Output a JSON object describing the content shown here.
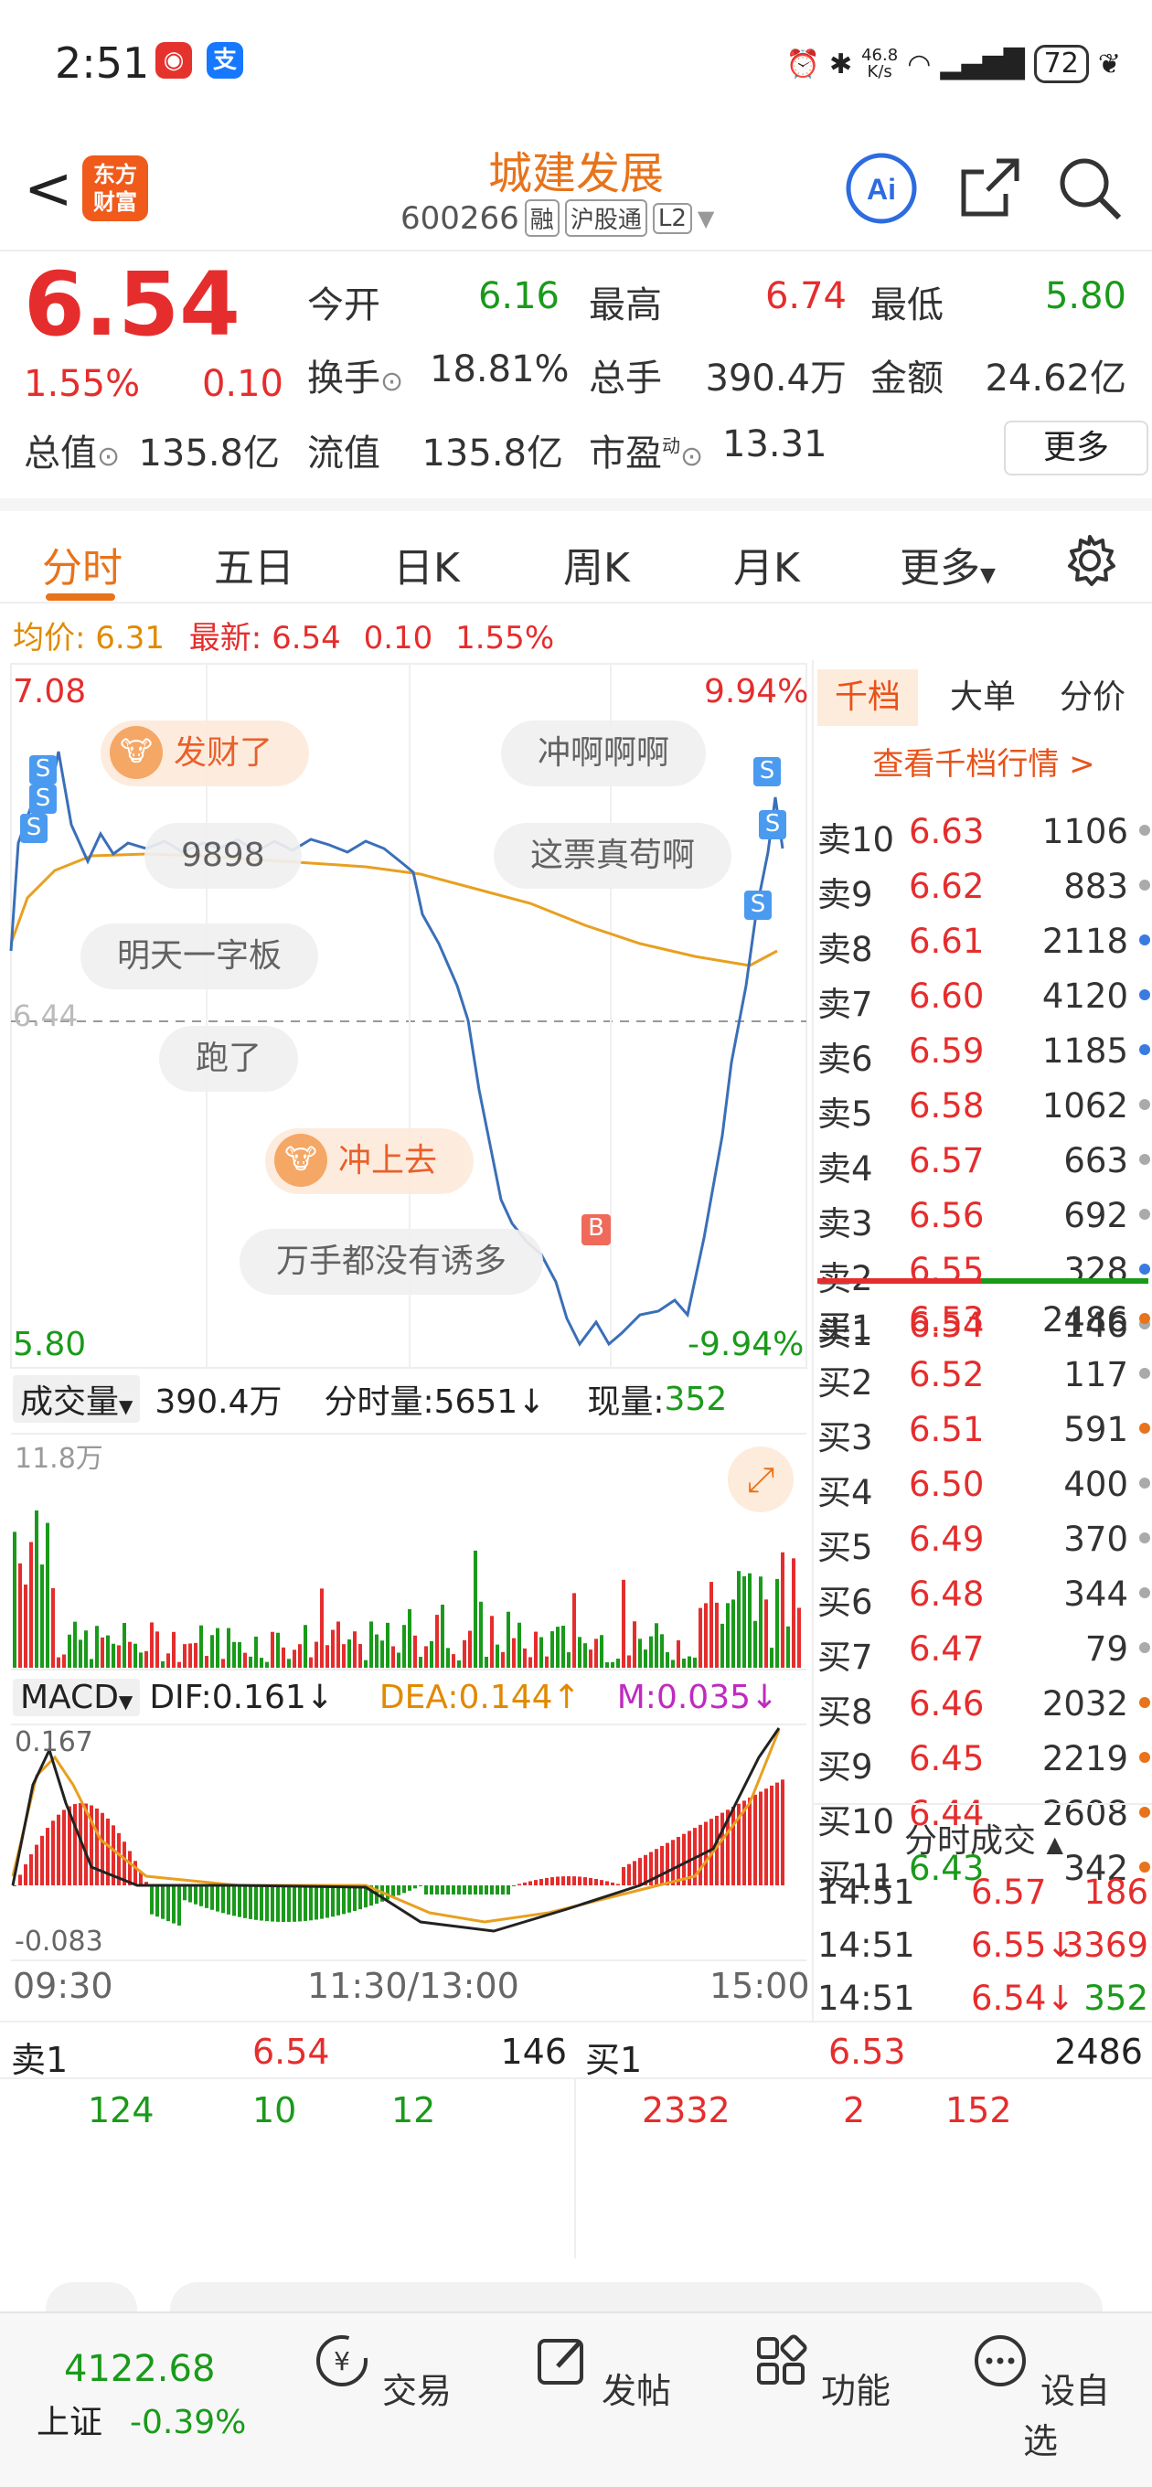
{
  "status_bar": {
    "time": "2:51",
    "net_speed": "46.8\nK/s",
    "battery": "72"
  },
  "header": {
    "title": "城建发展",
    "code": "600266",
    "tags": [
      "融",
      "沪股通",
      "L2"
    ],
    "logo_text": "东方\n财富",
    "ai_label": "Ai"
  },
  "quote": {
    "price": "6.54",
    "change_pct": "1.55%",
    "change": "0.10",
    "open_label": "今开",
    "open": "6.16",
    "high_label": "最高",
    "high": "6.74",
    "low_label": "最低",
    "low": "5.80",
    "turnover_label": "换手",
    "turnover": "18.81%",
    "volume_label": "总手",
    "volume": "390.4万",
    "amount_label": "金额",
    "amount": "24.62亿",
    "mktcap_label": "总值",
    "mktcap": "135.8亿",
    "float_label": "流值",
    "float": "135.8亿",
    "pe_label": "市盈",
    "pe_sup": "动",
    "pe": "13.31",
    "more": "更多"
  },
  "tabs": [
    "分时",
    "五日",
    "日K",
    "周K",
    "月K",
    "更多"
  ],
  "avg_bar": {
    "avg_label": "均价:",
    "avg": "6.31",
    "latest_label": "最新:",
    "latest": "6.54",
    "chg": "0.10",
    "pct": "1.55%"
  },
  "chart_labels": {
    "top_price": "7.08",
    "top_pct": "9.94%",
    "bottom_price": "5.80",
    "bottom_pct": "-9.94%",
    "mid_price": "6.44",
    "volume_selector": "成交量",
    "volume_total": "390.4万",
    "tick_volume": "分时量:5651↓",
    "now_volume_label": "现量:",
    "now_volume": "352",
    "vol_max": "11.8万",
    "macd_selector": "MACD",
    "dif": "DIF:0.161↓",
    "dea": "DEA:0.144↑",
    "m": "M:0.035↓",
    "macd_top": "0.167",
    "macd_bottom": "-0.083",
    "time_start": "09:30",
    "time_mid": "11:30/13:00",
    "time_end": "15:00",
    "buy_marker": "B",
    "sell_marker": "S"
  },
  "comments": [
    {
      "text": "发财了",
      "hot": true
    },
    {
      "text": "冲啊啊啊",
      "hot": false
    },
    {
      "text": "9898",
      "hot": false
    },
    {
      "text": "这票真苟啊",
      "hot": false
    },
    {
      "text": "明天一字板",
      "hot": false
    },
    {
      "text": "跑了",
      "hot": false
    },
    {
      "text": "冲上去",
      "hot": true
    },
    {
      "text": "万手都没有诱多",
      "hot": false
    }
  ],
  "depth": {
    "tabs": [
      "千档",
      "大单",
      "分价"
    ],
    "link": "查看千档行情 >",
    "sells": [
      {
        "label": "卖10",
        "price": "6.63",
        "vol": "1106",
        "dot": "gray"
      },
      {
        "label": "卖9",
        "price": "6.62",
        "vol": "883",
        "dot": "gray"
      },
      {
        "label": "卖8",
        "price": "6.61",
        "vol": "2118",
        "dot": "blue"
      },
      {
        "label": "卖7",
        "price": "6.60",
        "vol": "4120",
        "dot": "blue"
      },
      {
        "label": "卖6",
        "price": "6.59",
        "vol": "1185",
        "dot": "blue"
      },
      {
        "label": "卖5",
        "price": "6.58",
        "vol": "1062",
        "dot": "gray"
      },
      {
        "label": "卖4",
        "price": "6.57",
        "vol": "663",
        "dot": "gray"
      },
      {
        "label": "卖3",
        "price": "6.56",
        "vol": "692",
        "dot": "gray"
      },
      {
        "label": "卖2",
        "price": "6.55",
        "vol": "328",
        "dot": "blue"
      },
      {
        "label": "卖1",
        "price": "6.54",
        "vol": "146",
        "dot": "gray"
      }
    ],
    "buys": [
      {
        "label": "买1",
        "price": "6.53",
        "vol": "2486",
        "dot": "orange"
      },
      {
        "label": "买2",
        "price": "6.52",
        "vol": "117",
        "dot": "gray"
      },
      {
        "label": "买3",
        "price": "6.51",
        "vol": "591",
        "dot": "orange"
      },
      {
        "label": "买4",
        "price": "6.50",
        "vol": "400",
        "dot": "gray"
      },
      {
        "label": "买5",
        "price": "6.49",
        "vol": "370",
        "dot": "gray"
      },
      {
        "label": "买6",
        "price": "6.48",
        "vol": "344",
        "dot": "gray"
      },
      {
        "label": "买7",
        "price": "6.47",
        "vol": "79",
        "dot": "gray"
      },
      {
        "label": "买8",
        "price": "6.46",
        "vol": "2032",
        "dot": "orange"
      },
      {
        "label": "买9",
        "price": "6.45",
        "vol": "2219",
        "dot": "orange"
      },
      {
        "label": "买10",
        "price": "6.44",
        "vol": "2608",
        "dot": "orange"
      },
      {
        "label": "买11",
        "price": "6.43",
        "vol": "342",
        "dot": "orange"
      }
    ],
    "trades_title": "分时成交",
    "trades": [
      {
        "time": "14:51",
        "price": "6.57",
        "vol": "186"
      },
      {
        "time": "14:51",
        "price": "6.55↓",
        "vol": "3369"
      },
      {
        "time": "14:51",
        "price": "6.54↓",
        "vol": "352"
      }
    ]
  },
  "bottom": {
    "sell_label": "卖1",
    "sell_price": "6.54",
    "sell_vol": "146",
    "buy_label": "买1",
    "buy_price": "6.53",
    "buy_vol": "2486",
    "sell_breakdown": [
      "124",
      "10",
      "12"
    ],
    "buy_breakdown": [
      "2332",
      "2",
      "152"
    ]
  },
  "nav": {
    "index_value": "4122.68",
    "index_name": "上证",
    "index_change": "-0.39%",
    "items": [
      "交易",
      "发帖",
      "功能",
      "设自选"
    ]
  },
  "colors": {
    "up": "#e52d2d",
    "down": "#1a9a1a",
    "accent": "#e8731a",
    "price_line": "#3a6fb8",
    "avg_line": "#e8a020"
  }
}
